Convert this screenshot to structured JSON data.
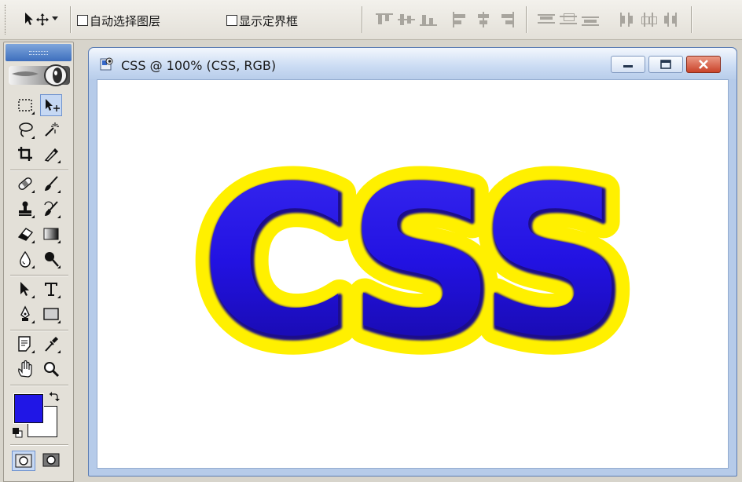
{
  "options_bar": {
    "auto_select_label": "自动选择图层",
    "show_bounds_label": "显示定界框"
  },
  "document": {
    "title": "CSS @ 100% (CSS, RGB)",
    "content_text": "CSS"
  },
  "colors": {
    "foreground": "#2016e6",
    "background": "#ffffff",
    "text_fill": "#2b14e6",
    "text_stroke": "#fff000",
    "title_gradient_top": "#f3f7fd",
    "close_button": "#c9432a"
  }
}
